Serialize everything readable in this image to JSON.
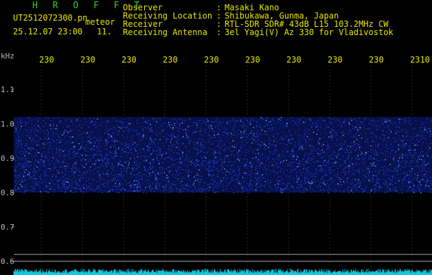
{
  "header": {
    "brand": "H R O F F T",
    "filename": "UT2512072300.pn",
    "mode": "meteor",
    "datetime": "25.12.07 23:00",
    "index": "11.",
    "fields": [
      {
        "label": "Observer",
        "value": "Masaki Kano"
      },
      {
        "label": "Receiving Location",
        "value": "Shibukawa, Gunma, Japan"
      },
      {
        "label": "Receiver",
        "value": "RTL-SDR SDR# 43dB L15 103.2MHz CW"
      },
      {
        "label": "Receiving Antenna",
        "value": "3el Yagi(V) Az 330 for Vladivostok"
      }
    ]
  },
  "axes": {
    "y_unit": "kHz",
    "y_ticks": [
      "1.1",
      "1.0",
      "0.9",
      "0.8",
      "0.7",
      "0.6"
    ],
    "x_ticks": [
      "230",
      "230",
      "230",
      "230",
      "230",
      "230",
      "230",
      "230",
      "230",
      "2310"
    ]
  },
  "colors": {
    "background": "#000000",
    "text_yellow": "#e8e800",
    "brand_green": "#2bd62b",
    "signal_blue": "#2a44d8",
    "signal_bright": "#7ab8ff",
    "grid": "#2a2a2a",
    "baseline": "#aaaaaa",
    "noise_cyan": "#12c8e0"
  },
  "spectrogram": {
    "band_khz": [
      0.8,
      1.02
    ]
  }
}
